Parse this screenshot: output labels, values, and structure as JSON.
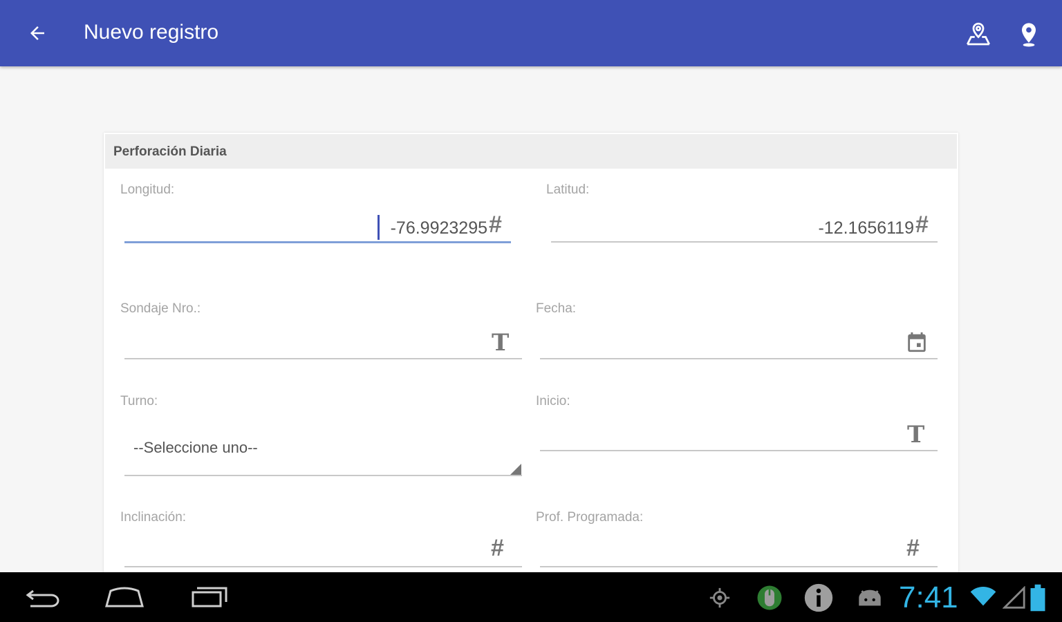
{
  "appbar": {
    "title": "Nuevo registro",
    "bg": "#3f51b5",
    "icons": [
      "arrow-left-icon",
      "map-marker-area-icon",
      "location-pin-icon"
    ]
  },
  "card": {
    "header": "Perforación Diaria",
    "fields": {
      "longitud": {
        "label": "Longitud:",
        "value": "-76.9923295"
      },
      "latitud": {
        "label": "Latitud:",
        "value": "-12.1656119"
      },
      "sondaje": {
        "label": "Sondaje Nro.:",
        "value": ""
      },
      "fecha": {
        "label": "Fecha:",
        "value": ""
      },
      "turno": {
        "label": "Turno:",
        "value": "--Seleccione uno--"
      },
      "inicio": {
        "label": "Inicio:",
        "value": ""
      },
      "inclinacion": {
        "label": "Inclinación:",
        "value": ""
      },
      "prof_programada": {
        "label": "Prof. Programada:",
        "value": ""
      }
    }
  },
  "icons": {
    "number": "#",
    "text": "T"
  },
  "statusbar": {
    "time": "7:41",
    "accent": "#33b5e5",
    "icons": [
      "location-icon",
      "mouse-icon",
      "info-icon",
      "android-icon",
      "wifi-icon",
      "signal-icon",
      "battery-icon"
    ]
  }
}
